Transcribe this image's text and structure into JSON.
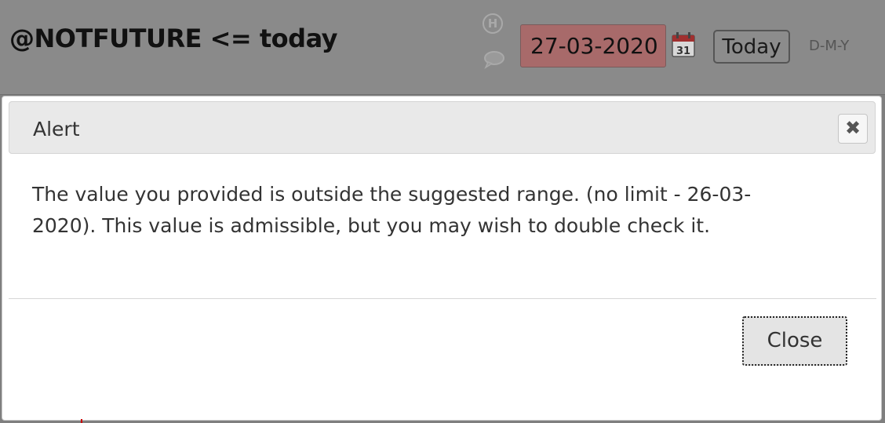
{
  "field": {
    "label": "@NOTFUTURE <= today",
    "history_icon": "history-icon",
    "history_glyph": "H",
    "comment_icon": "comment-icon",
    "date_value": "27-03-2020",
    "calendar_icon": "calendar-icon",
    "calendar_day": "31",
    "today_label": "Today",
    "format_label": "D-M-Y",
    "invalid_color": "#a86a6a"
  },
  "dialog": {
    "title": "Alert",
    "close_icon": "close-icon",
    "close_glyph": "✖",
    "message": "The value you provided is outside the suggested range. (no limit - 26-03-2020). This value is admissible, but you may wish to double check it.",
    "close_button_label": "Close"
  }
}
